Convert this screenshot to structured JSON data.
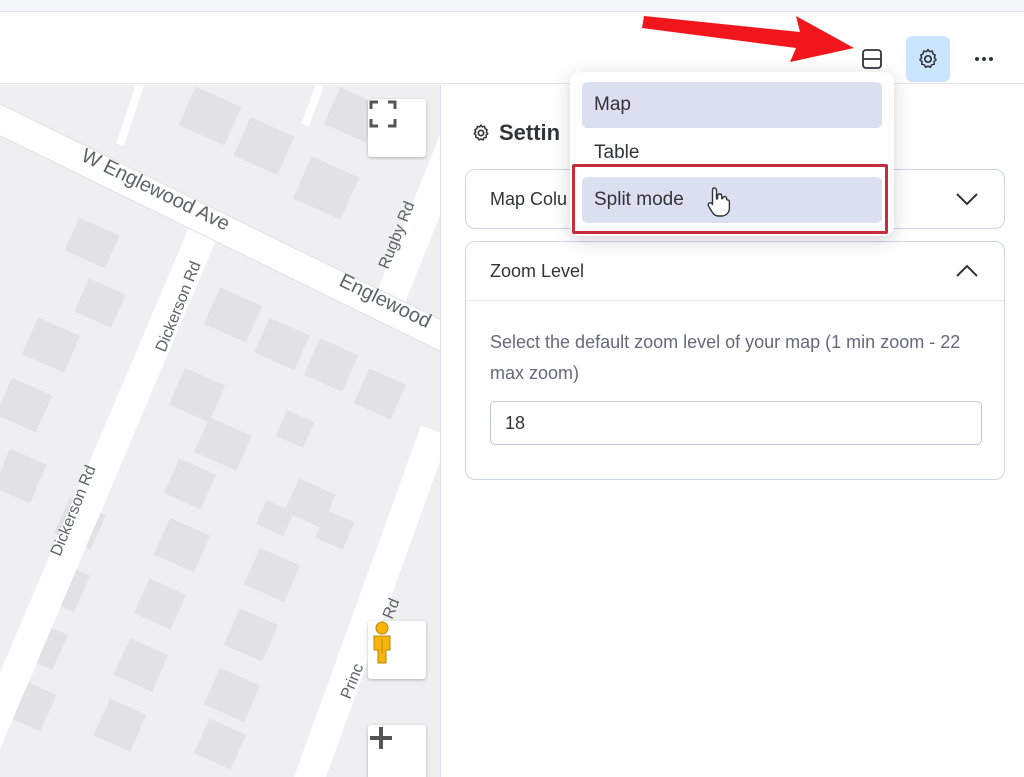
{
  "toolbar": {
    "layout_icon": "split-layout-icon",
    "settings_icon": "gear-icon",
    "more_icon": "more-horizontal-icon",
    "accent": "#cce5ff"
  },
  "annotation": {
    "arrow_color": "#f0161b",
    "highlight_color": "#c62d3a"
  },
  "map": {
    "streets": [
      "W Englewood Ave",
      "Englewood",
      "Rugby Rd",
      "Dickerson Rd",
      "Dickerson Rd",
      "Princ",
      "Rd"
    ],
    "fullscreen_icon": "fullscreen-icon",
    "pegman_icon": "street-view-pegman-icon",
    "zoom_in_icon": "plus-icon"
  },
  "dropdown": {
    "items": [
      {
        "label": "Map",
        "selected": true
      },
      {
        "label": "Table",
        "selected": false
      },
      {
        "label": "Split mode",
        "selected": true
      }
    ]
  },
  "panel": {
    "title": "Settin",
    "map_columns_label": "Map Colu",
    "zoom": {
      "label": "Zoom Level",
      "description": "Select the default zoom level of your map (1 min zoom - 22 max zoom)",
      "value": "18"
    }
  }
}
